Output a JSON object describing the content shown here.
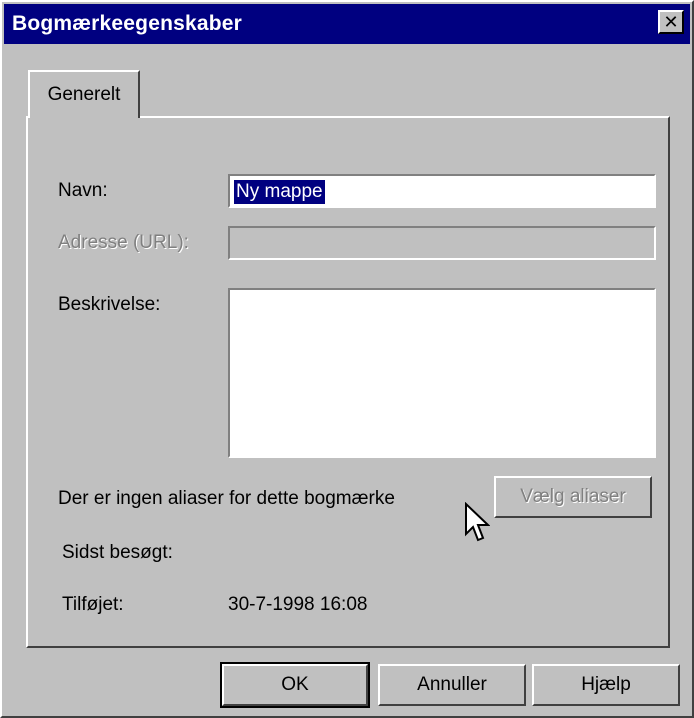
{
  "window": {
    "title": "Bogmærkeegenskaber",
    "close_glyph": "✕"
  },
  "tabs": [
    {
      "label": "Generelt",
      "selected": true
    }
  ],
  "form": {
    "name_label": "Navn:",
    "name_value": "Ny mappe",
    "address_label": "Adresse (URL):",
    "address_value": "",
    "description_label": "Beskrivelse:",
    "description_value": "",
    "aliases_text": "Der er ingen aliaser for dette bogmærke",
    "choose_aliases_label": "Vælg aliaser",
    "last_visited_label": "Sidst besøgt:",
    "last_visited_value": "",
    "added_label": "Tilføjet:",
    "added_value": "30-7-1998 16:08"
  },
  "buttons": {
    "ok": "OK",
    "cancel": "Annuller",
    "help": "Hjælp"
  },
  "colors": {
    "titlebar": "#000080",
    "face": "#c0c0c0",
    "selection": "#000080"
  }
}
